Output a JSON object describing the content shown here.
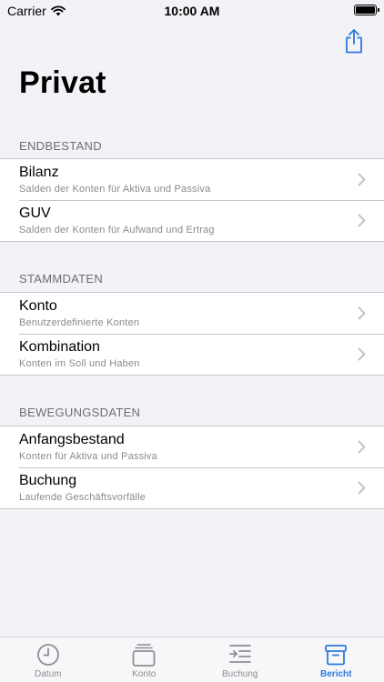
{
  "status_bar": {
    "carrier": "Carrier",
    "time": "10:00 AM"
  },
  "page_title": "Privat",
  "sections": [
    {
      "header": "ENDBESTAND",
      "rows": [
        {
          "title": "Bilanz",
          "subtitle": "Salden der Konten für Aktiva und Passiva"
        },
        {
          "title": "GUV",
          "subtitle": "Salden der Konten für Aufwand und Ertrag"
        }
      ]
    },
    {
      "header": "STAMMDATEN",
      "rows": [
        {
          "title": "Konto",
          "subtitle": "Benutzerdefinierte Konten"
        },
        {
          "title": "Kombination",
          "subtitle": "Konten im Soll und Haben"
        }
      ]
    },
    {
      "header": "BEWEGUNGSDATEN",
      "rows": [
        {
          "title": "Anfangsbestand",
          "subtitle": "Konten für Aktiva und Passiva"
        },
        {
          "title": "Buchung",
          "subtitle": "Laufende Geschäftsvorfälle"
        }
      ]
    }
  ],
  "tabs": [
    {
      "label": "Datum",
      "icon": "clock-icon",
      "active": false
    },
    {
      "label": "Konto",
      "icon": "stack-icon",
      "active": false
    },
    {
      "label": "Buchung",
      "icon": "transfer-list-icon",
      "active": false
    },
    {
      "label": "Bericht",
      "icon": "archive-box-icon",
      "active": true
    }
  ],
  "colors": {
    "accent": "#2c7ae0",
    "inactive": "#8e8e93",
    "background": "#f2f2f7"
  }
}
